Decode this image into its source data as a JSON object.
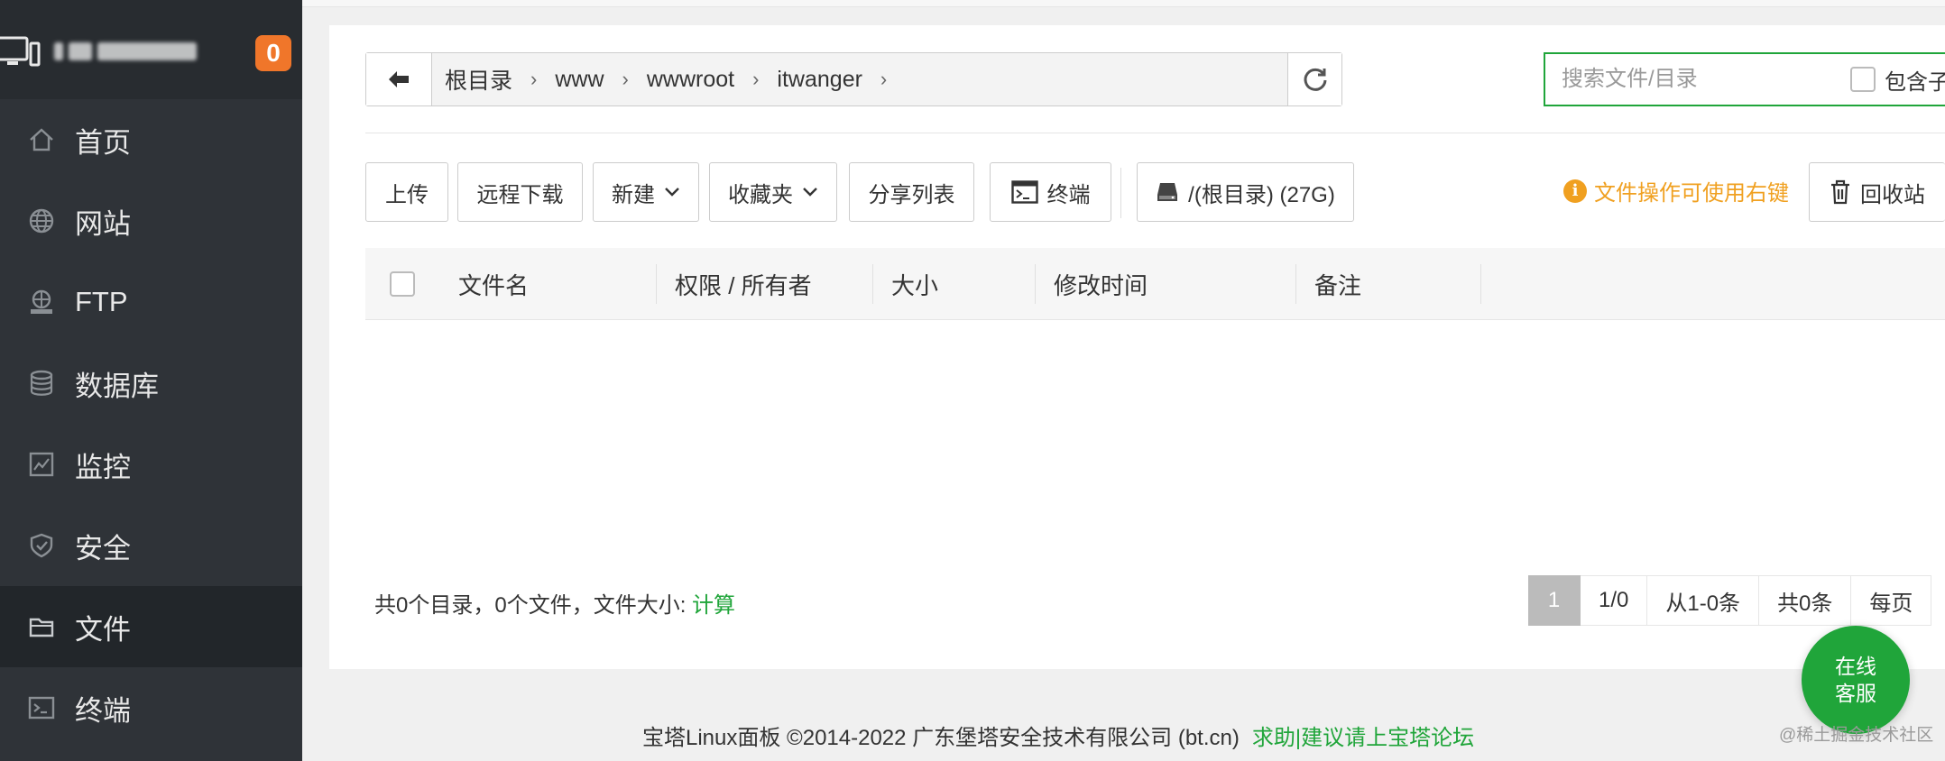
{
  "sidebar": {
    "badge_count": "0",
    "items": [
      {
        "label": "首页",
        "icon": "home-icon"
      },
      {
        "label": "网站",
        "icon": "globe-icon"
      },
      {
        "label": "FTP",
        "icon": "ftp-icon"
      },
      {
        "label": "数据库",
        "icon": "database-icon"
      },
      {
        "label": "监控",
        "icon": "monitor-chart-icon"
      },
      {
        "label": "安全",
        "icon": "shield-icon"
      },
      {
        "label": "文件",
        "icon": "folder-icon",
        "active": true
      },
      {
        "label": "终端",
        "icon": "terminal-icon"
      }
    ]
  },
  "pathbar": {
    "crumbs": [
      "根目录",
      "www",
      "wwwroot",
      "itwanger"
    ]
  },
  "search": {
    "placeholder": "搜索文件/目录",
    "include_sub_label": "包含子目录"
  },
  "toolbar": {
    "upload": "上传",
    "remote_download": "远程下载",
    "new": "新建",
    "favorites": "收藏夹",
    "share_list": "分享列表",
    "terminal": "终端",
    "disk": "/(根目录) (27G)",
    "tip": "文件操作可使用右键",
    "recycle_bin": "回收站"
  },
  "table": {
    "columns": [
      "文件名",
      "权限 / 所有者",
      "大小",
      "修改时间",
      "备注"
    ]
  },
  "summary": {
    "text": "共0个目录，0个文件，文件大小: ",
    "calc_link": "计算"
  },
  "pager": {
    "current": "1",
    "pages": "1/0",
    "range": "从1-0条",
    "total": "共0条",
    "per_page": "每页"
  },
  "footer": {
    "copyright": "宝塔Linux面板 ©2014-2022 广东堡塔安全技术有限公司 (bt.cn)",
    "help_link": "求助|建议请上宝塔论坛"
  },
  "kefu": {
    "line1": "在线",
    "line2": "客服"
  },
  "watermark": "@稀土掘金技术社区",
  "colors": {
    "accent": "#20a53a",
    "sidebar": "#2f3338",
    "badge": "#f0762a",
    "tip": "#f0a020"
  }
}
